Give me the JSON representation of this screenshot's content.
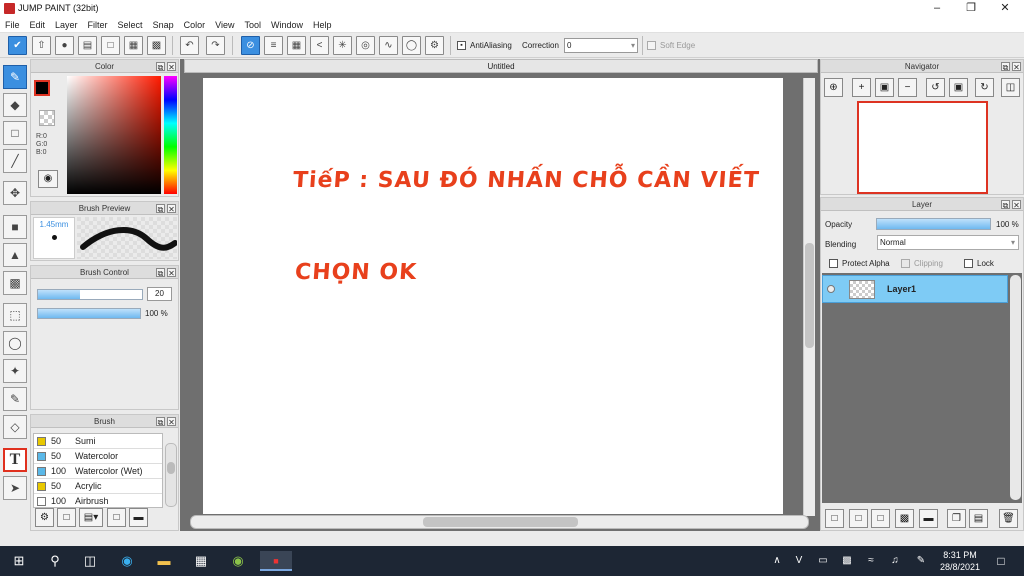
{
  "app": {
    "title": "JUMP PAINT (32bit)"
  },
  "menu": [
    "File",
    "Edit",
    "Layer",
    "Filter",
    "Select",
    "Snap",
    "Color",
    "View",
    "Tool",
    "Window",
    "Help"
  ],
  "toolbar": {
    "antialias_label": "AntiAliasing",
    "correction_label": "Correction",
    "correction_value": "0",
    "softedge_label": "Soft Edge"
  },
  "color_panel": {
    "title": "Color",
    "r": "R:0",
    "g": "G:0",
    "b": "B:0"
  },
  "brush_preview": {
    "title": "Brush Preview",
    "size": "1.45mm"
  },
  "brush_control": {
    "title": "Brush Control",
    "size_value": "20",
    "opacity_value": "100 %"
  },
  "brush_list": {
    "title": "Brush",
    "items": [
      {
        "size": "50",
        "name": "Sumi",
        "color": "#e8c800"
      },
      {
        "size": "50",
        "name": "Watercolor",
        "color": "#5ab8e8"
      },
      {
        "size": "100",
        "name": "Watercolor (Wet)",
        "color": "#5ab8e8"
      },
      {
        "size": "50",
        "name": "Acrylic",
        "color": "#e8c800"
      },
      {
        "size": "100",
        "name": "Airbrush",
        "color": "#ffffff"
      }
    ]
  },
  "document": {
    "tab": "Untitled",
    "line1": "TiếP : SAU ĐÓ NHẤN CHỖ CẦN VIẾT",
    "line2": "CHỌN OK"
  },
  "navigator": {
    "title": "Navigator"
  },
  "layer_panel": {
    "title": "Layer",
    "opacity_label": "Opacity",
    "opacity_value": "100 %",
    "blending_label": "Blending",
    "blending_value": "Normal",
    "protect_alpha": "Protect Alpha",
    "clipping": "Clipping",
    "lock": "Lock",
    "layer_name": "Layer1"
  },
  "taskbar": {
    "time": "8:31 PM",
    "date": "28/8/2021"
  },
  "colors": {
    "accent": "#3b8fe0",
    "text_red": "#e8401c",
    "layer_selected": "#7ecbf5"
  }
}
